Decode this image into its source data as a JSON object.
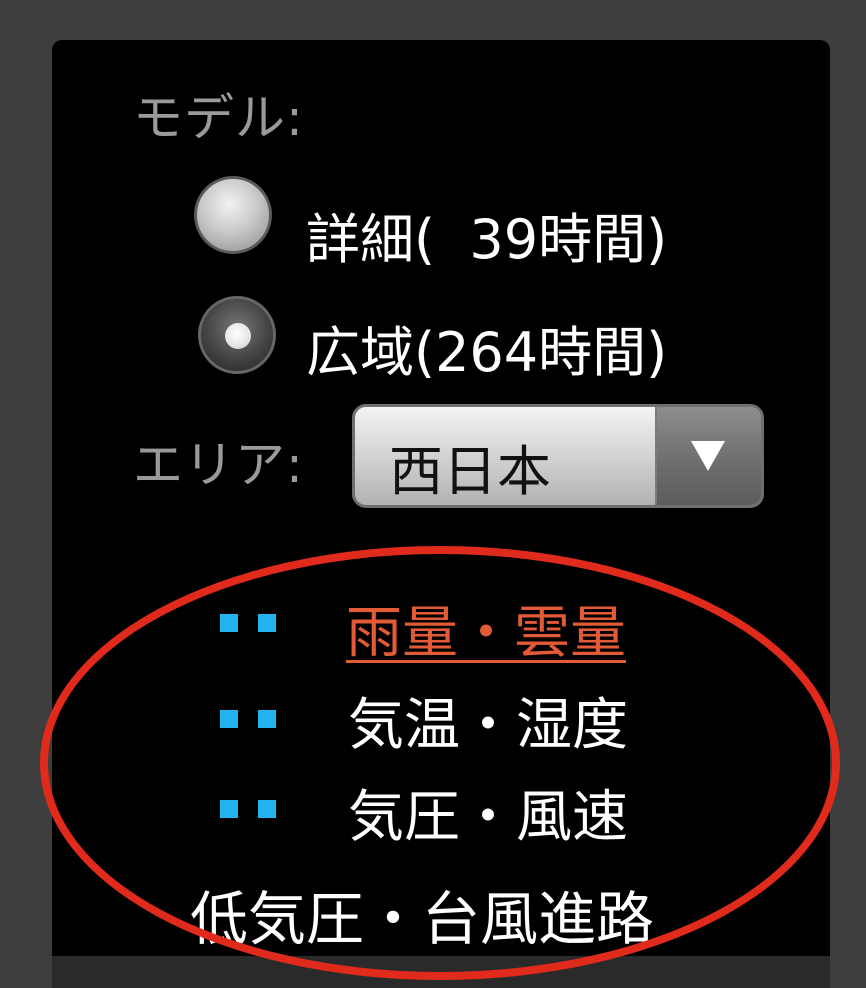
{
  "model": {
    "label": "モデル:",
    "options": [
      {
        "label": "詳細(  39時間)",
        "selected": false
      },
      {
        "label": "広域(264時間)",
        "selected": true
      }
    ]
  },
  "area": {
    "label": "エリア:",
    "selected": "西日本"
  },
  "menu": {
    "items": [
      {
        "label": "雨量・雲量",
        "active": true
      },
      {
        "label": "気温・湿度",
        "active": false
      },
      {
        "label": "気圧・風速",
        "active": false
      },
      {
        "label": "低気圧・台風進路",
        "active": false
      }
    ]
  },
  "colors": {
    "panel_background": "#000000",
    "page_background": "#3e3e3e",
    "active_link": "#e25a36",
    "bullet": "#22b3f0",
    "annotation_circle": "#e02a1c"
  }
}
